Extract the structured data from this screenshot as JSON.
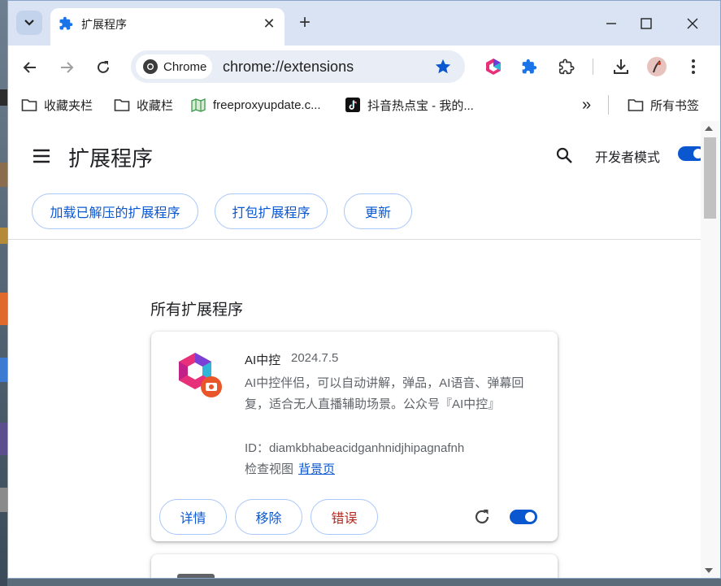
{
  "tab": {
    "title": "扩展程序",
    "close": "✕"
  },
  "window_controls": {
    "minimize": "─",
    "maximize": "☐",
    "close": "✕"
  },
  "toolbar": {
    "chip_label": "Chrome",
    "url": "chrome://extensions"
  },
  "bookmarks": {
    "items": [
      {
        "label": "收藏夹栏",
        "icon": "folder-icon"
      },
      {
        "label": "收藏栏",
        "icon": "folder-icon"
      },
      {
        "label": "freeproxyupdate.c...",
        "icon": "map-icon"
      },
      {
        "label": "抖音热点宝 - 我的...",
        "icon": "tiktok-icon"
      }
    ],
    "more": "»",
    "all_bookmarks": "所有书签"
  },
  "page": {
    "title": "扩展程序",
    "dev_mode_label": "开发者模式",
    "dev_mode_on": true,
    "buttons": {
      "load_unpacked": "加载已解压的扩展程序",
      "pack": "打包扩展程序",
      "update": "更新"
    },
    "section_title": "所有扩展程序"
  },
  "extension": {
    "name": "AI中控",
    "version": "2024.7.5",
    "description": "AI中控伴侣，可以自动讲解，弹品，AI语音、弹幕回复，适合无人直播辅助场景。公众号『AI中控』",
    "id": "ID：diamkbhabeacidganhnidjhipagnafnh",
    "views_label": "检查视图",
    "views_link": "背景页",
    "details_btn": "详情",
    "remove_btn": "移除",
    "errors_btn": "错误",
    "enabled": true
  },
  "colors": {
    "accent": "#0b57d0",
    "error": "#b3261e",
    "titlebar": "#dae3f3"
  }
}
